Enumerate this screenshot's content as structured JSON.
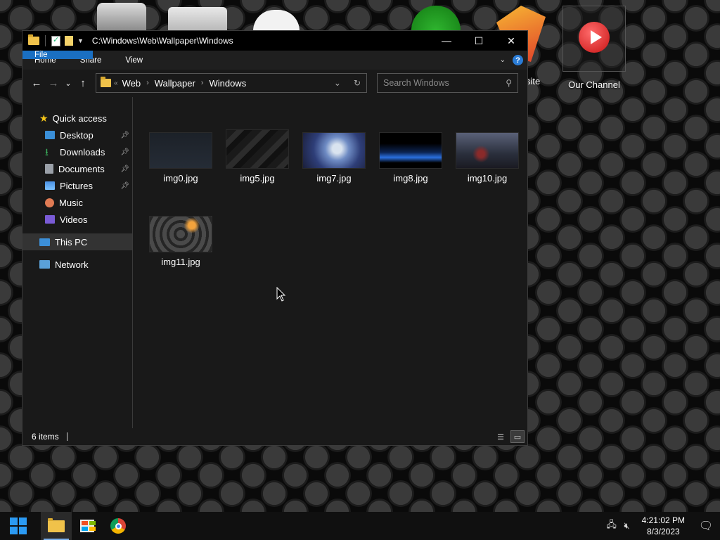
{
  "desktop": {
    "icons": [
      {
        "name": "recycle-bin",
        "label": ""
      },
      {
        "name": "folder",
        "label": ""
      },
      {
        "name": "gamepad",
        "label": ""
      },
      {
        "name": "xbox",
        "label": ""
      },
      {
        "name": "website",
        "label": "site"
      },
      {
        "name": "our-channel",
        "label": "Our Channel"
      }
    ]
  },
  "window": {
    "title": "C:\\Windows\\Web\\Wallpaper\\Windows",
    "controls": {
      "minimize": "—",
      "maximize": "☐",
      "close": "✕"
    },
    "ribbon_tabs": [
      "File",
      "Home",
      "Share",
      "View"
    ],
    "address": {
      "overflow": "«",
      "crumbs": [
        "Web",
        "Wallpaper",
        "Windows"
      ]
    },
    "search": {
      "placeholder": "Search Windows"
    },
    "nav_pane": {
      "quick_access": "Quick access",
      "quick_items": [
        {
          "label": "Desktop",
          "pinned": true,
          "color": "#3a8fd8"
        },
        {
          "label": "Downloads",
          "pinned": true,
          "color": "#3bb15d"
        },
        {
          "label": "Documents",
          "pinned": true,
          "color": "#9aa0a8"
        },
        {
          "label": "Pictures",
          "pinned": true,
          "color": "#4a90e2"
        },
        {
          "label": "Music",
          "pinned": false,
          "color": "#e07b54"
        },
        {
          "label": "Videos",
          "pinned": false,
          "color": "#7a5bd6"
        }
      ],
      "this_pc": "This PC",
      "network": "Network"
    },
    "files": [
      {
        "name": "img0.jpg",
        "thumb": "dark-blue"
      },
      {
        "name": "img5.jpg",
        "thumb": "dark-cubes"
      },
      {
        "name": "img7.jpg",
        "thumb": "anime"
      },
      {
        "name": "img8.jpg",
        "thumb": "city-night"
      },
      {
        "name": "img10.jpg",
        "thumb": "hex-red"
      },
      {
        "name": "img11.jpg",
        "thumb": "hex-orange"
      }
    ],
    "status": {
      "items": "6 items"
    }
  },
  "taskbar": {
    "clock_time": "4:21:02 PM",
    "clock_date": "8/3/2023"
  }
}
